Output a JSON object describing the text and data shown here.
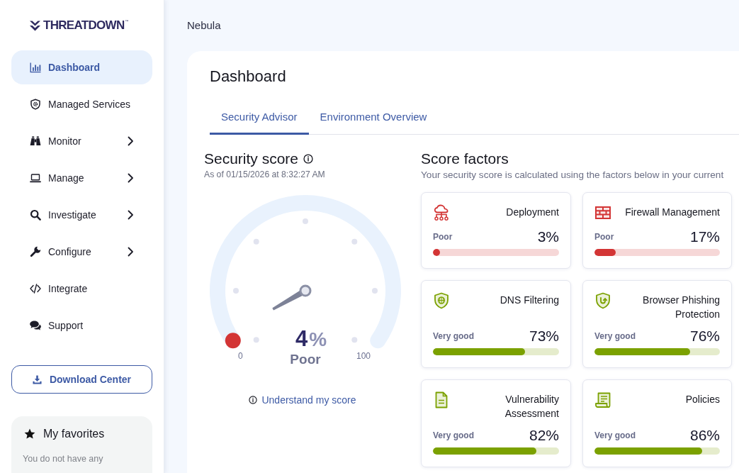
{
  "sidebar": {
    "logo": "THREATDOWN$^{™}$",
    "nav": [
      {
        "label": "Dashboard",
        "selected": true,
        "expandable": false
      },
      {
        "label": "Managed Services",
        "selected": false,
        "expandable": false
      },
      {
        "label": "Monitor",
        "selected": false,
        "expandable": true
      },
      {
        "label": "Manage",
        "selected": false,
        "expandable": true
      },
      {
        "label": "Investigate",
        "selected": false,
        "expandable": true
      },
      {
        "label": "Configure",
        "selected": false,
        "expandable": true
      },
      {
        "label": "Integrate",
        "selected": false,
        "expandable": false
      },
      {
        "label": "Support",
        "selected": false,
        "expandable": false
      }
    ],
    "download_button": "Download Center",
    "favorites": {
      "title": "My favorites",
      "text": "You do not have any"
    }
  },
  "header": {
    "title": "Nebula"
  },
  "page": {
    "title": "Dashboard",
    "tabs": [
      {
        "label": "Security Advisor",
        "selected": true
      },
      {
        "label": "Environment Overview",
        "selected": false
      }
    ]
  },
  "security_score": {
    "title": "Security score",
    "timestamp": "As of 01/15/2026 at 8:32:27 AM",
    "gauge": {
      "min_label": "0",
      "max_label": "100",
      "value": "4",
      "unit": "%",
      "rating": "Poor",
      "color": "#d33535"
    },
    "link": "Understand my score"
  },
  "score_factors": {
    "title": "Score factors",
    "subtitle": "Your security score is calculated using the factors below in your current",
    "factors": [
      {
        "title": "Deployment",
        "rating": "Poor",
        "value": "3%",
        "level": 0.03,
        "color": "#d33535"
      },
      {
        "title": "Firewall Management",
        "rating": "Poor",
        "value": "17%",
        "level": 0.17,
        "color": "#d33535"
      },
      {
        "title": "DNS Filtering",
        "rating": "Very good",
        "value": "73%",
        "level": 0.73,
        "color": "#7ba100"
      },
      {
        "title": "Browser Phishing Protection",
        "rating": "Very good",
        "value": "76%",
        "level": 0.76,
        "color": "#7ba100"
      },
      {
        "title": "Vulnerability Assessment",
        "rating": "Very good",
        "value": "82%",
        "level": 0.82,
        "color": "#7ba100"
      },
      {
        "title": "Policies",
        "rating": "Very good",
        "value": "86%",
        "level": 0.86,
        "color": "#7ba100"
      }
    ]
  }
}
